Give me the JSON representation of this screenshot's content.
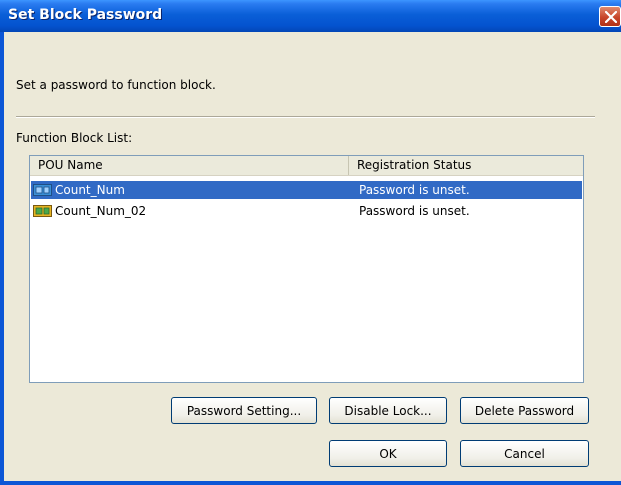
{
  "window": {
    "title": "Set Block Password"
  },
  "description": "Set a password to function block.",
  "list_label": "Function Block List:",
  "table": {
    "columns": [
      "POU Name",
      "Registration Status"
    ],
    "rows": [
      {
        "name": "Count_Num",
        "status": "Password is unset.",
        "selected": true
      },
      {
        "name": "Count_Num_02",
        "status": "Password is unset.",
        "selected": false
      }
    ]
  },
  "buttons": {
    "password_setting": "Password Setting...",
    "disable_lock": "Disable Lock...",
    "delete_password": "Delete Password",
    "ok": "OK",
    "cancel": "Cancel"
  },
  "colors": {
    "titlebar": "#0453cf",
    "selection": "#316ac5",
    "dialog_bg": "#ece9d8"
  },
  "icons": {
    "row_icon": "function-block-icon",
    "close": "close-icon"
  }
}
